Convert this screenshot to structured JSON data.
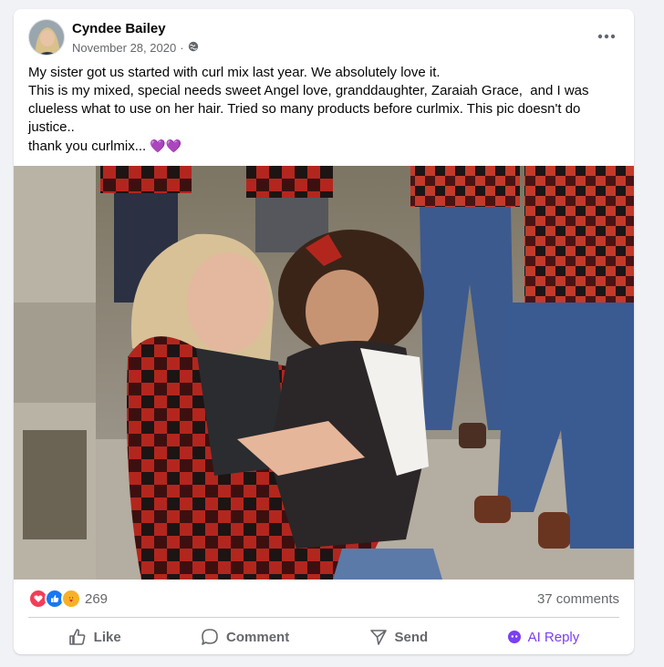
{
  "post": {
    "author": "Cyndee Bailey",
    "date": "November 28, 2020",
    "date_separator": "·",
    "privacy_icon": "globe-icon",
    "more_icon": "more-options-icon",
    "text_lines": [
      "My sister got us started with curl mix last year. We absolutely love it.",
      "This is my mixed, special needs sweet Angel love, granddaughter, Zaraiah Grace,  and I was clueless what to use on her hair. Tried so many products before curlmix. This pic doesn't do justice..",
      "thank you curlmix... "
    ],
    "emoji": "💜💜"
  },
  "reactions": {
    "icons": [
      "love-reaction-icon",
      "like-reaction-icon",
      "care-reaction-icon"
    ],
    "count": "269",
    "comments": "37 comments"
  },
  "actions": {
    "like": "Like",
    "comment": "Comment",
    "send": "Send",
    "ai_reply": "AI Reply"
  },
  "colors": {
    "accent_ai": "#7b3ff2",
    "like_blue": "#1877f2",
    "love_red": "#f33e58",
    "care_yellow": "#f7b125",
    "muted_text": "#65676b"
  }
}
